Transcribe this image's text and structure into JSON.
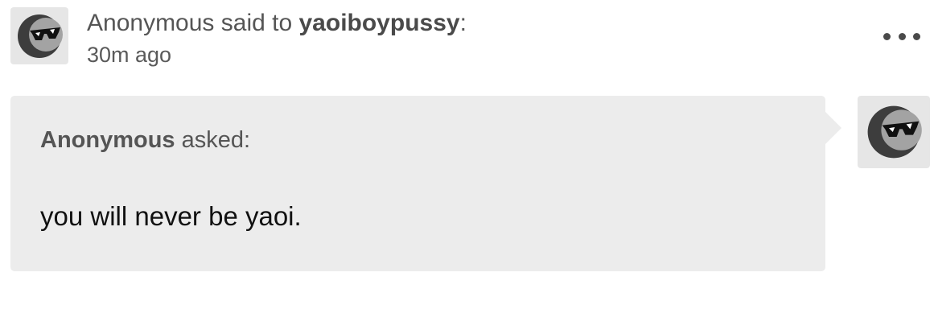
{
  "post_header": {
    "author": "Anonymous",
    "said_to": " said to ",
    "recipient": "yaoiboypussy",
    "colon": ":",
    "timestamp": "30m ago",
    "avatar_icon": "anonymous-sunglasses-icon",
    "more_icon": "more-options-icon"
  },
  "ask": {
    "asker": "Anonymous",
    "asked_label": " asked:",
    "question": "you will never be yaoi.",
    "background_color": "#ececec"
  },
  "answer": {
    "avatar_icon": "anonymous-sunglasses-icon"
  }
}
